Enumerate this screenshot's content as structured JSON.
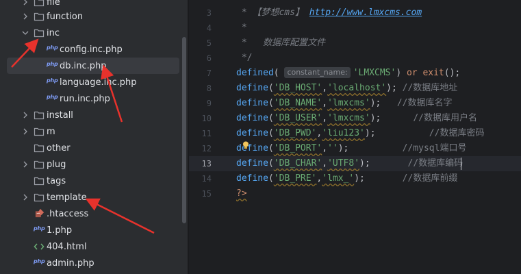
{
  "tree": {
    "items": [
      {
        "label": "file",
        "type": "folder",
        "expandable": true,
        "expanded": false
      },
      {
        "label": "function",
        "type": "folder",
        "expandable": true,
        "expanded": false
      },
      {
        "label": "inc",
        "type": "folder",
        "expandable": true,
        "expanded": true
      },
      {
        "label": "config.inc.php",
        "type": "php"
      },
      {
        "label": "db.inc.php",
        "type": "php",
        "selected": true
      },
      {
        "label": "language.inc.php",
        "type": "php"
      },
      {
        "label": "run.inc.php",
        "type": "php"
      },
      {
        "label": "install",
        "type": "folder",
        "expandable": true,
        "expanded": false
      },
      {
        "label": "m",
        "type": "folder",
        "expandable": true,
        "expanded": false
      },
      {
        "label": "other",
        "type": "folder",
        "expandable": false
      },
      {
        "label": "plug",
        "type": "folder",
        "expandable": true,
        "expanded": false
      },
      {
        "label": "tags",
        "type": "folder",
        "expandable": false
      },
      {
        "label": "template",
        "type": "folder",
        "expandable": true,
        "expanded": false
      },
      {
        "label": ".htaccess",
        "type": "htaccess"
      },
      {
        "label": "1.php",
        "type": "php"
      },
      {
        "label": "404.html",
        "type": "html"
      },
      {
        "label": "admin.php",
        "type": "php"
      }
    ],
    "php_badge": "php"
  },
  "editor": {
    "current_line": "13",
    "lines": [
      {
        "num": "3"
      },
      {
        "num": "4"
      },
      {
        "num": "5"
      },
      {
        "num": "6"
      },
      {
        "num": "7"
      },
      {
        "num": "8"
      },
      {
        "num": "9"
      },
      {
        "num": "10"
      },
      {
        "num": "11"
      },
      {
        "num": "12"
      },
      {
        "num": "13"
      },
      {
        "num": "14"
      },
      {
        "num": "15"
      }
    ],
    "code": {
      "l3_star": " * ",
      "l3_brand": "【梦想cms】",
      "l3_url": "http://www.lmxcms.com",
      "l4": " *",
      "l5_star": " *",
      "l5_text": "数据库配置文件",
      "l6": " */",
      "l7_fn": "defined",
      "l7_hint": "constant_name:",
      "l7_str": "'LMXCMS'",
      "l7_or": "or",
      "l7_exit": "exit",
      "define": "define",
      "l8_k": "'DB_HOST'",
      "l8_v": "'localhost'",
      "l8_c": "//数据库地址",
      "l9_k": "'DB_NAME'",
      "l9_v": "'lmxcms'",
      "l9_c": "//数据库名字",
      "l10_k": "'DB_USER'",
      "l10_v": "'lmxcms'",
      "l10_c": "//数据库用户名",
      "l11_k": "'DB_PWD'",
      "l11_v": "'liu123'",
      "l11_c": "//数据库密码",
      "l12_k": "'DB_PORT'",
      "l12_v": "''",
      "l12_c": "//mysql端口号",
      "l13_k": "'DB_CHAR'",
      "l13_v": "'UTF8'",
      "l13_c": "//数据库编码",
      "l14_k": "'DB_PRE'",
      "l14_v": "'lmx_'",
      "l14_c": "//数据库前缀",
      "l15": "?>"
    }
  },
  "colors": {
    "annotation_arrow": "#e8322c",
    "keyword": "#cf8e6d",
    "function": "#56a8f5",
    "string": "#6aab73",
    "comment": "#7a7e85"
  }
}
